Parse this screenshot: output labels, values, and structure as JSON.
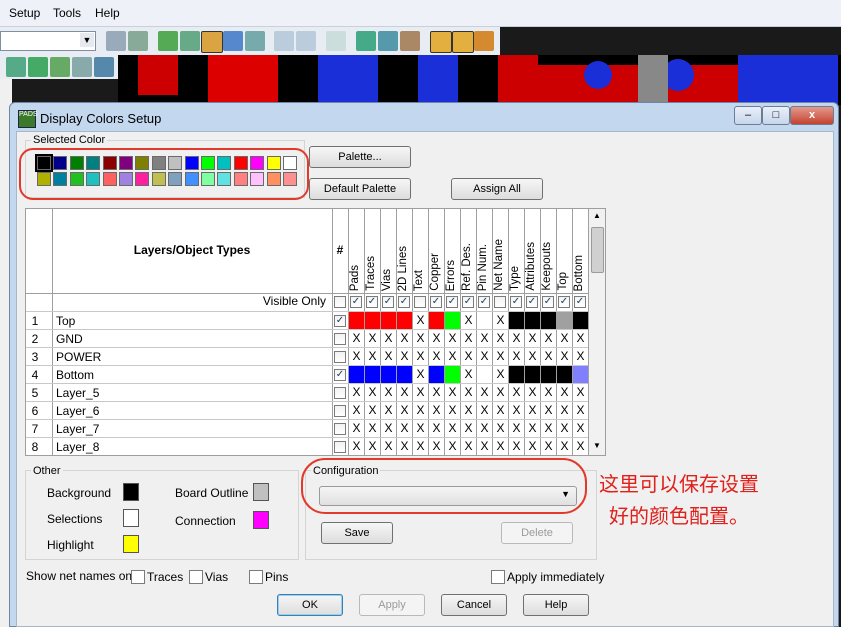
{
  "menu": {
    "items": [
      "Setup",
      "Tools",
      "Help"
    ]
  },
  "dialog": {
    "title": "Display Colors Setup",
    "selected_color": {
      "label": "Selected Color",
      "row1": [
        "#000000",
        "#00008b",
        "#008000",
        "#008080",
        "#8b0000",
        "#800080",
        "#808000",
        "#808080",
        "#c0c0c0",
        "#0000ff",
        "#00ff00",
        "#00c0c0",
        "#ff0000",
        "#ff00ff",
        "#ffff00",
        "#ffffff"
      ],
      "row2": [
        "#b0b000",
        "#0080a0",
        "#20c020",
        "#20c0c0",
        "#ff6060",
        "#a080e0",
        "#ff20a0",
        "#c0c050",
        "#80a0c0",
        "#4090ff",
        "#80ffa0",
        "#60e0e0",
        "#ff8080",
        "#ffc0ff",
        "#ff9060",
        "#ff9090"
      ],
      "selected_index": 0
    },
    "buttons": {
      "palette": "Palette...",
      "default_palette": "Default Palette",
      "assign_all": "Assign All"
    },
    "grid": {
      "header": "Layers/Object Types",
      "hash": "#",
      "columns": [
        "Pads",
        "Traces",
        "Vias",
        "2D Lines",
        "Text",
        "Copper",
        "Errors",
        "Ref. Des.",
        "Pin Num.",
        "Net Name",
        "Type",
        "Attributes",
        "Keepouts",
        "Top",
        "Bottom"
      ],
      "visible_only_label": "Visible Only",
      "rows": [
        {
          "num": "1",
          "name": "Top",
          "checked": true,
          "cells": [
            "#ff0000",
            "#ff0000",
            "#ff0000",
            "#ff0000",
            "X",
            "#ff0000",
            "#00ff00",
            "X",
            "",
            "X",
            "#000000",
            "#000000",
            "#000000",
            "#a0a0a0",
            "#000000"
          ]
        },
        {
          "num": "2",
          "name": "GND",
          "checked": false,
          "cells": [
            "X",
            "X",
            "X",
            "X",
            "X",
            "X",
            "X",
            "X",
            "X",
            "X",
            "X",
            "X",
            "X",
            "X",
            "X"
          ]
        },
        {
          "num": "3",
          "name": "POWER",
          "checked": false,
          "cells": [
            "X",
            "X",
            "X",
            "X",
            "X",
            "X",
            "X",
            "X",
            "X",
            "X",
            "X",
            "X",
            "X",
            "X",
            "X"
          ]
        },
        {
          "num": "4",
          "name": "Bottom",
          "checked": true,
          "cells": [
            "#0000ff",
            "#0000ff",
            "#0000ff",
            "#0000ff",
            "X",
            "#0000ff",
            "#00ff00",
            "X",
            "",
            "X",
            "#000000",
            "#000000",
            "#000000",
            "#000000",
            "#8080ff"
          ]
        },
        {
          "num": "5",
          "name": "Layer_5",
          "checked": false,
          "cells": [
            "X",
            "X",
            "X",
            "X",
            "X",
            "X",
            "X",
            "X",
            "X",
            "X",
            "X",
            "X",
            "X",
            "X",
            "X"
          ]
        },
        {
          "num": "6",
          "name": "Layer_6",
          "checked": false,
          "cells": [
            "X",
            "X",
            "X",
            "X",
            "X",
            "X",
            "X",
            "X",
            "X",
            "X",
            "X",
            "X",
            "X",
            "X",
            "X"
          ]
        },
        {
          "num": "7",
          "name": "Layer_7",
          "checked": false,
          "cells": [
            "X",
            "X",
            "X",
            "X",
            "X",
            "X",
            "X",
            "X",
            "X",
            "X",
            "X",
            "X",
            "X",
            "X",
            "X"
          ]
        },
        {
          "num": "8",
          "name": "Layer_8",
          "checked": false,
          "cells": [
            "X",
            "X",
            "X",
            "X",
            "X",
            "X",
            "X",
            "X",
            "X",
            "X",
            "X",
            "X",
            "X",
            "X",
            "X"
          ]
        }
      ]
    },
    "other": {
      "label": "Other",
      "background": "Background",
      "background_color": "#000000",
      "selections": "Selections",
      "selections_color": "#ffffff",
      "highlight": "Highlight",
      "highlight_color": "#ffff00",
      "board_outline": "Board Outline",
      "board_outline_color": "#c0c0c0",
      "connection": "Connection",
      "connection_color": "#ff00ff"
    },
    "configuration": {
      "label": "Configuration",
      "value": "",
      "save": "Save",
      "delete": "Delete"
    },
    "annotation": {
      "line1": "这里可以保存设置",
      "line2": "好的颜色配置。"
    },
    "show_net_names": {
      "label": "Show net names on",
      "traces": "Traces",
      "vias": "Vias",
      "pins": "Pins"
    },
    "apply_immediately": "Apply immediately",
    "footer": {
      "ok": "OK",
      "apply": "Apply",
      "cancel": "Cancel",
      "help": "Help"
    },
    "window_buttons": {
      "minimize": "–",
      "maximize": "□",
      "close": "x"
    }
  }
}
